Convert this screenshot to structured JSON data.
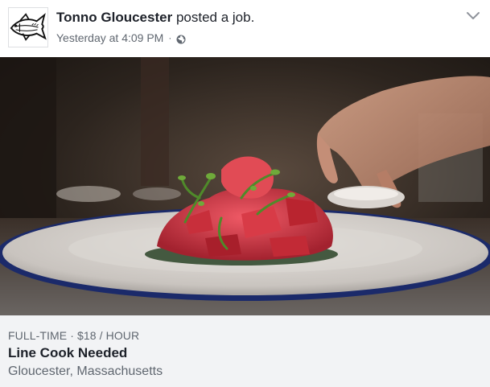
{
  "post": {
    "actor_name": "Tonno Gloucester",
    "action_text": "posted a job.",
    "timestamp": "Yesterday at 4:09 PM",
    "separator": "·",
    "privacy_icon": "globe-icon",
    "menu_icon": "chevron-down-icon",
    "avatar_icon": "tuna-fish-logo"
  },
  "job": {
    "type_line": "FULL-TIME · $18 / HOUR",
    "title": "Line Cook Needed",
    "location": "Gloucester, Massachusetts"
  },
  "colors": {
    "text_primary": "#1d2129",
    "text_secondary": "#606770",
    "job_panel_bg": "#f2f3f5"
  }
}
